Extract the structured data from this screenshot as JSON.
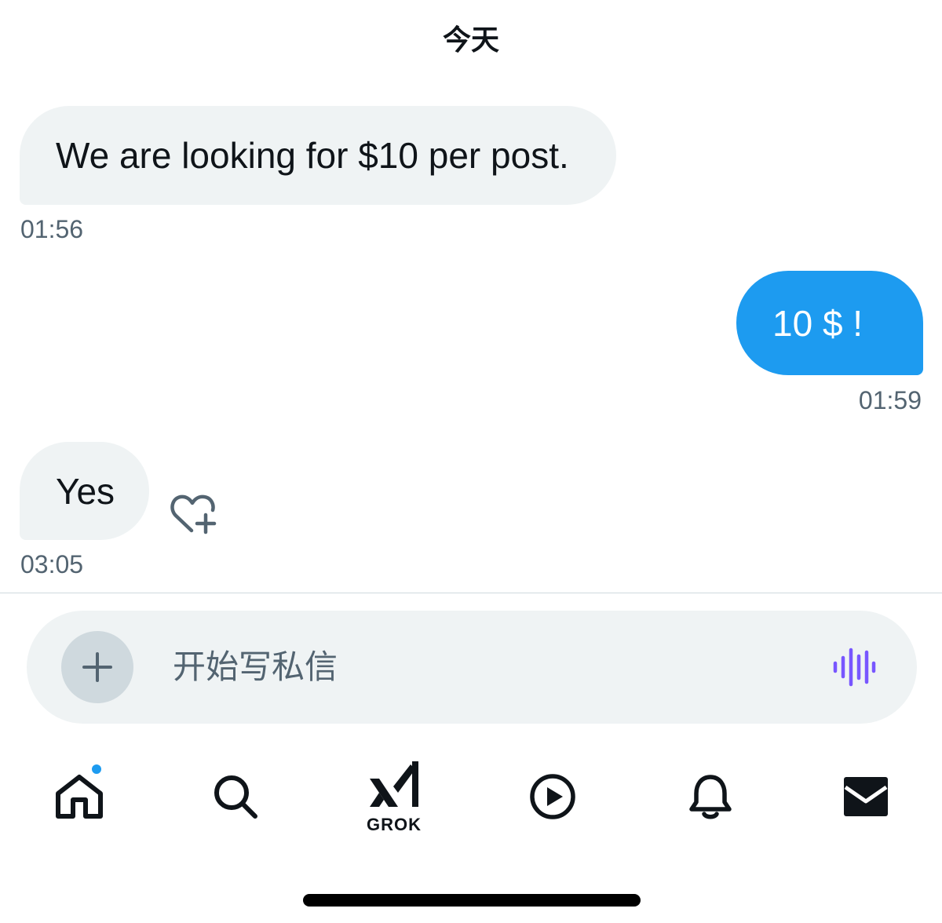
{
  "header": {
    "day_label": "今天"
  },
  "messages": [
    {
      "text": "We are looking for $10 per post.",
      "time": "01:56",
      "direction": "incoming"
    },
    {
      "text": "10 $ !",
      "time": "01:59",
      "direction": "outgoing"
    },
    {
      "text": "Yes",
      "time": "03:05",
      "direction": "incoming"
    }
  ],
  "composer": {
    "placeholder": "开始写私信",
    "value": ""
  },
  "tabbar": {
    "grok_label": "GROK",
    "tabs": [
      "home-icon",
      "search-icon",
      "grok-icon",
      "play-icon",
      "bell-icon",
      "mail-icon"
    ]
  },
  "colors": {
    "accent": "#1d9bf0",
    "incoming_bubble": "#eff3f4",
    "timestamp": "#536471",
    "voice": "#7856ff"
  }
}
